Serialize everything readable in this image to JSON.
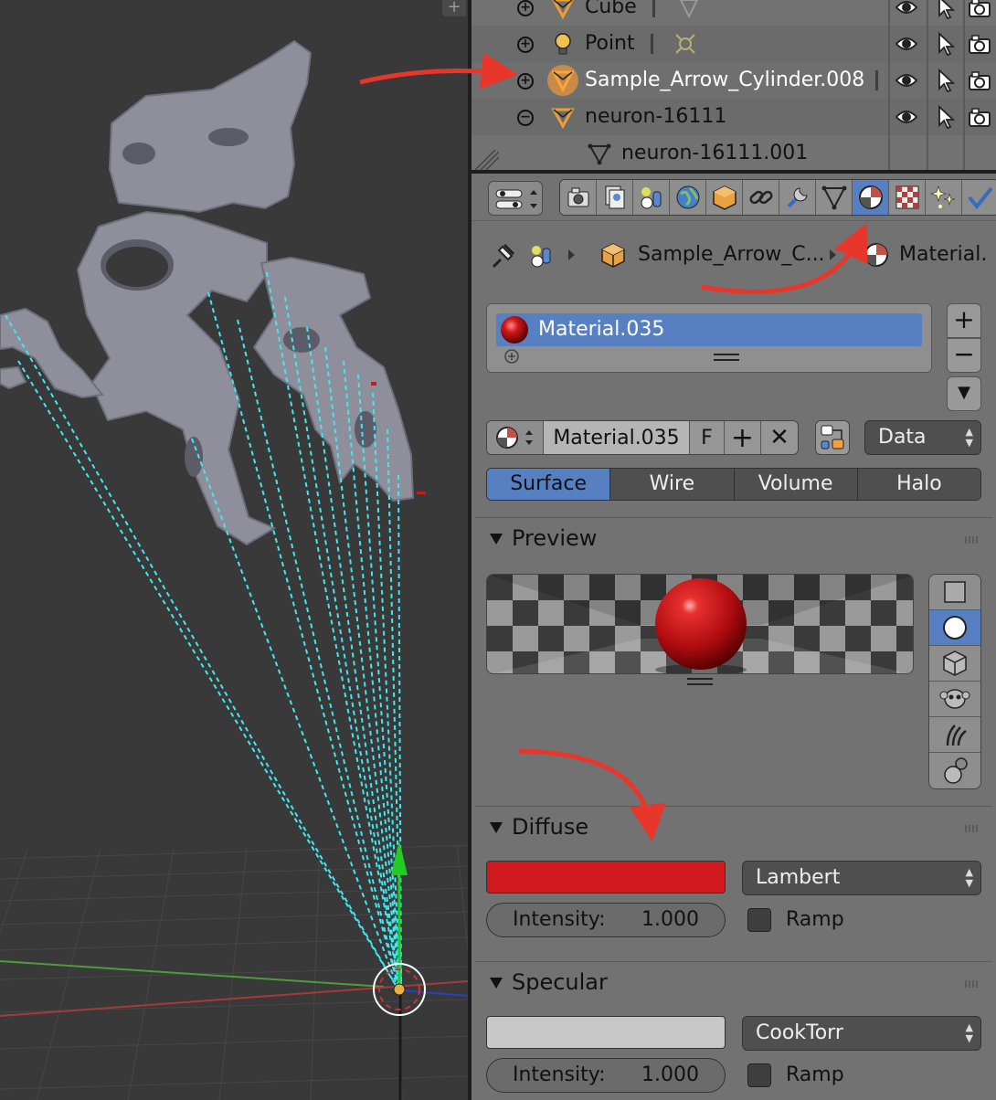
{
  "colors": {
    "accent": "#5680c2",
    "annotation_arrow": "#e8362a",
    "diffuse": "#d0191f",
    "specular": "#c8c8c8",
    "mesh": "#8f8f9c",
    "ray": "#40e8f0",
    "viewport_bg": "#393939"
  },
  "viewport": {
    "corner_label": "+"
  },
  "outliner": {
    "rows": [
      {
        "name": "Cube",
        "icon": "mesh-data-icon",
        "expander": "+"
      },
      {
        "name": "Point",
        "icon": "lamp-icon",
        "expander": "+"
      },
      {
        "name": "Sample_Arrow_Cylinder.008",
        "icon": "mesh-data-icon",
        "expander": "+",
        "selected": true
      },
      {
        "name": "neuron-16111",
        "icon": "mesh-data-icon",
        "expander": "−"
      },
      {
        "name": "neuron-16111.001",
        "icon": "mesh-data-icon",
        "expander": ""
      }
    ],
    "restrict_icons": [
      "eye-icon",
      "cursor-icon",
      "camera-icon"
    ]
  },
  "properties": {
    "context_tabs": [
      "render",
      "render-layers",
      "scene",
      "world",
      "object",
      "constraints",
      "modifiers",
      "data",
      "material",
      "texture",
      "particles",
      "physics"
    ],
    "active_tab": "material",
    "breadcrumb": {
      "object": "Sample_Arrow_C...",
      "material": "Material."
    },
    "slots": [
      {
        "name": "Material.035"
      }
    ],
    "slot_buttons": {
      "add": "+",
      "remove": "−",
      "menu": "▼"
    },
    "material_id": {
      "name": "Material.035",
      "fake_user": "F",
      "add": "+",
      "unlink": "✕",
      "link": "Data"
    },
    "type_tabs": [
      "Surface",
      "Wire",
      "Volume",
      "Halo"
    ],
    "active_type": "Surface",
    "preview": {
      "title": "Preview",
      "shapes": [
        "flat-icon",
        "sphere-icon",
        "cube-icon",
        "monkey-icon",
        "hair-icon",
        "sphere-lamp-icon"
      ],
      "active_shape": "sphere-icon"
    },
    "diffuse": {
      "title": "Diffuse",
      "shader": "Lambert",
      "intensity_label": "Intensity:",
      "intensity": "1.000",
      "ramp_label": "Ramp"
    },
    "specular": {
      "title": "Specular",
      "shader": "CookTorr",
      "intensity_label": "Intensity:",
      "intensity": "1.000",
      "ramp_label": "Ramp"
    }
  }
}
